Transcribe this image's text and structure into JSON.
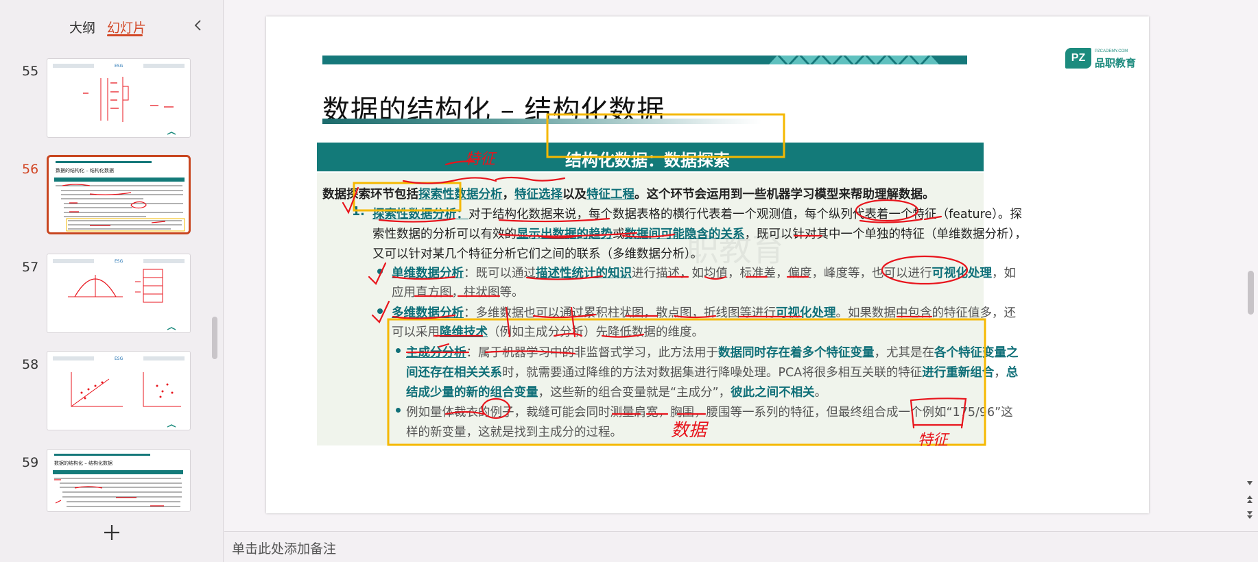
{
  "left_panel": {
    "tab_outline": "大纲",
    "tab_slides": "幻灯片",
    "thumbnails": [
      {
        "num": "55",
        "title": "ESG",
        "active": false
      },
      {
        "num": "56",
        "title": "数据的结构化 – 结构化数据",
        "active": true
      },
      {
        "num": "57",
        "title": "ESG",
        "active": false
      },
      {
        "num": "58",
        "title": "ESG",
        "active": false
      },
      {
        "num": "59",
        "title": "数据的结构化 – 结构化数据",
        "active": false
      }
    ]
  },
  "notes": {
    "placeholder": "单击此处添加备注"
  },
  "slide": {
    "logo": {
      "badge": "PZ",
      "small": "PZCADEMY.COM",
      "name": "品职教育"
    },
    "title": "数据的结构化 – 结构化数据",
    "section_title": "结构化数据：数据探索",
    "watermark": "职教育",
    "intro": {
      "a": "数据探索环节包括",
      "b": "探索性数据分析",
      "c": "，",
      "d": "特征选择",
      "e": "以及",
      "f": "特征工程",
      "g": "。这个环节会运用到一些机器学习模型来帮助理解数据。"
    },
    "item1": {
      "num": "1.",
      "head": "探索性数据分析：",
      "l1": "对于结构化数据来说，每个数据表格的横行代表着一个观测值，每个纵列代表着一个特征（feature）。探",
      "l2a": "索性数据的分析可以有效的",
      "l2b": "显示出数据的趋势",
      "l2c": "或",
      "l2d": "数据间可能隐含的关系",
      "l2e": "，既可以针对其中一个单独的特征（单维数据分析），",
      "l3": "又可以针对某几个特征分析它们之间的联系（多维数据分析）。"
    },
    "bullet1": {
      "head": "单维数据分析",
      "a": "：既可以通过",
      "b": "描述性统计的知识",
      "c": "进行描述，如均值，标准差，偏度，峰度等，也可以进行",
      "d": "可视化处理",
      "e": "，如",
      "l2": "应用直方图，柱状图等。"
    },
    "bullet2": {
      "head": "多维数据分析",
      "a": "：多维数据也可以通过累积柱状图，散点图，折线图等进行",
      "b": "可视化处理",
      "c": "。如果数据中包含的特征值多，还",
      "l2a": "可以采用",
      "l2b": "降维技术",
      "l2c": "（例如主成分分析）先降低数据的维度。"
    },
    "sub1": {
      "head": "主成分分析",
      "a": "：属于机器学习中的非监督式学习，此方法用于",
      "b": "数据同时存在着多个特征变量",
      "c": "，尤其是在",
      "d": "各个特征变量之",
      "l2a": "间还存在相关关系",
      "l2b": "时，就需要通过降维的方法对数据集进行降噪处理。PCA将很多相互关联的特征",
      "l2c": "进行重新组合",
      "l2d": "，",
      "l2e": "总",
      "l3a": "结成少量的新的组合变量",
      "l3b": "，这些新的组合变量就是“主成分”，",
      "l3c": "彼此之间不相关",
      "l3d": "。"
    },
    "sub2": {
      "l1": "例如量体裁衣的例子，裁缝可能会同时测量肩宽，胸围，腰围等一系列的特征，但最终组合成一个例如“175/96”这",
      "l2": "样的新变量，这就是找到主成分的过程。"
    },
    "handwriting": {
      "a1": "特征",
      "a2": "数据",
      "a3": "特征"
    }
  },
  "colors": {
    "accent": "#d24726",
    "teal": "#137a79",
    "ink_red": "#e8141c",
    "highlight_box": "#f5b800"
  }
}
